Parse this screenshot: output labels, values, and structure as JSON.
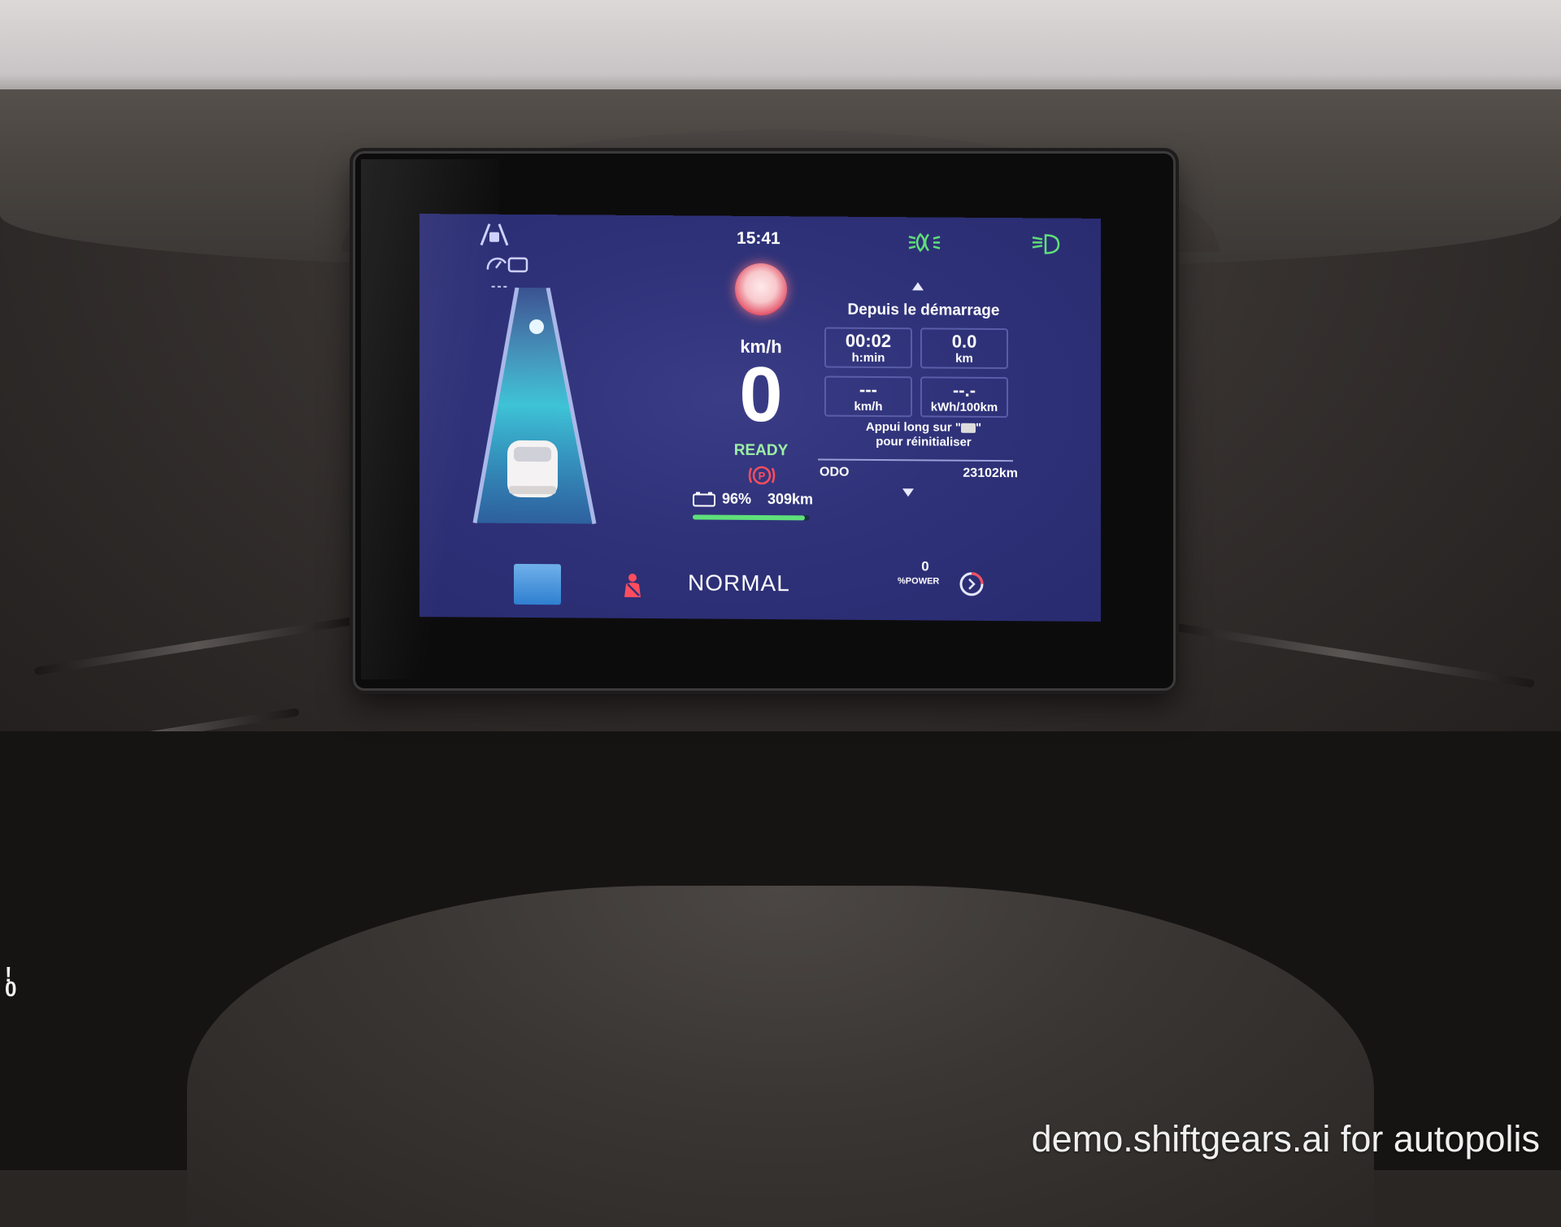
{
  "cluster": {
    "clock": "15:41",
    "speed_unit": "km/h",
    "speed_value": "0",
    "status": "READY",
    "battery_percent": "96%",
    "battery_level": 0.96,
    "range": "309km",
    "drive_mode": "NORMAL",
    "acc_set_speed": "---",
    "power": {
      "value": "0",
      "label": "%POWER"
    }
  },
  "trip": {
    "title": "Depuis le démarrage",
    "duration": {
      "value": "00:02",
      "unit": "h:min"
    },
    "distance": {
      "value": "0.0",
      "unit": "km"
    },
    "avg_speed": {
      "value": "---",
      "unit": "km/h"
    },
    "consumption": {
      "value": "--.-",
      "unit": "kWh/100km"
    },
    "reset_hint_line1_before": "Appui long sur \"",
    "reset_hint_line1_after": "\"",
    "reset_hint_line2": "pour réinitialiser",
    "odo_label": "ODO",
    "odo_value": "23102km"
  },
  "colors": {
    "screen_bg": "#2f3279",
    "ready": "#9cf0a4",
    "indicator_green": "#5fe07a",
    "speed_sign_red": "#e1435a",
    "seatbelt_red": "#ff4d5e"
  },
  "watermark": "demo.shiftgears.ai for autopolis",
  "side_indicator": {
    "top": "!",
    "bottom": "0"
  }
}
